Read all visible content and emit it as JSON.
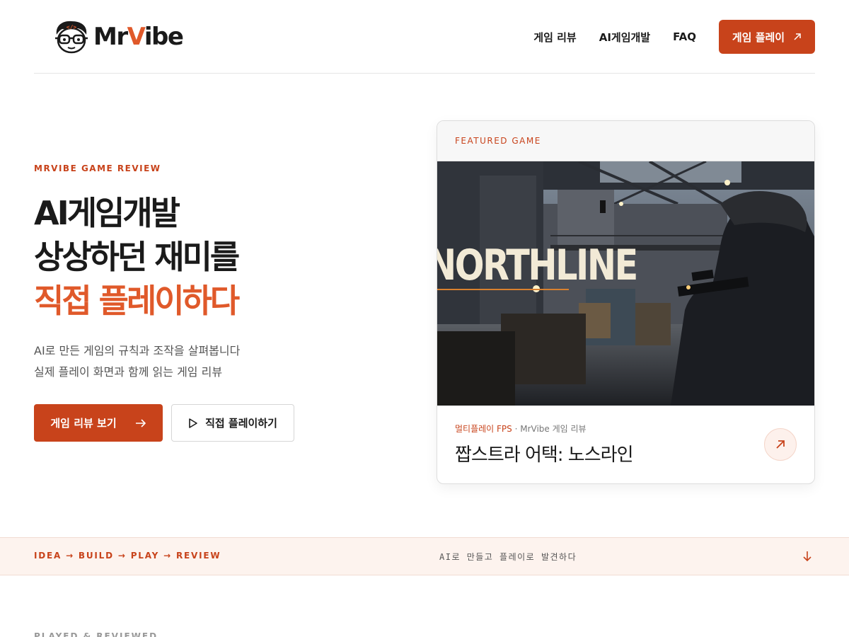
{
  "header": {
    "logo": {
      "part1": "Mr",
      "part2": "V",
      "part3": "ibe",
      "face_icon": "mascot-face-icon",
      "code_glyph": "</>"
    },
    "nav": [
      {
        "label": "게임 리뷰"
      },
      {
        "label": "AI게임개발"
      },
      {
        "label": "FAQ"
      }
    ],
    "cta": {
      "label": "게임 플레이",
      "icon": "arrow-up-right-icon"
    }
  },
  "hero": {
    "eyebrow": "MRVIBE GAME REVIEW",
    "headline_line1": "AI게임개발",
    "headline_line2": "상상하던 재미를",
    "headline_line3": "직접 플레이하다",
    "sub_line1": "AI로 만든 게임의 규칙과 조작을 살펴봅니다",
    "sub_line2": "실제 플레이 화면과 함께 읽는 게임 리뷰",
    "primary_button": {
      "label": "게임 리뷰 보기",
      "icon": "arrow-right-icon"
    },
    "secondary_button": {
      "label": "직접 플레이하기",
      "icon": "play-icon"
    }
  },
  "featured": {
    "label": "FEATURED GAME",
    "image_title": "NORTHLINE",
    "category": "멀티플레이 FPS",
    "separator": " · ",
    "source": "MrVibe 게임 리뷰",
    "title": "짭스트라 어택: 노스라인",
    "icon": "arrow-up-right-icon"
  },
  "strip": {
    "flow": "IDEA → BUILD → PLAY → REVIEW",
    "tagline": "AI로 만들고 플레이로 발견하다",
    "icon": "arrow-down-icon"
  },
  "next_section": {
    "label": "PLAYED & REVIEWED"
  },
  "colors": {
    "accent": "#c8431b",
    "accent_light": "#e0592a",
    "strip_bg": "#fdf3ee"
  }
}
